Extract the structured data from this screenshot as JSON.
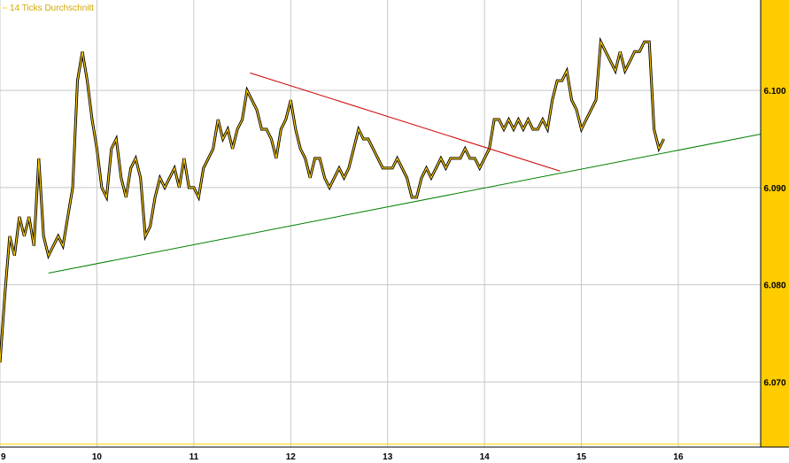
{
  "chart_data": {
    "type": "line",
    "legend": {
      "label": "14 Ticks Durchschnitt",
      "placement": "top-left"
    },
    "x_axis": {
      "range": [
        9,
        16.85
      ],
      "ticks": [
        "9",
        "10",
        "11",
        "12",
        "13",
        "14",
        "15",
        "16"
      ]
    },
    "y_axis": {
      "range": [
        6.0633,
        6.1093
      ],
      "side": "right",
      "ticks": [
        "6.070",
        "6.080",
        "6.090",
        "6.100"
      ]
    },
    "grid": true,
    "colors": {
      "price": "#000000",
      "average": "#ffcc00",
      "axis_panel": "#ffcc00",
      "resistance": "#cc0000",
      "support": "#008000",
      "reference": "#ffcc00"
    },
    "series": [
      {
        "name": "14 Ticks Durchschnitt",
        "points": [
          [
            9.0,
            6.072
          ],
          [
            9.05,
            6.079
          ],
          [
            9.1,
            6.085
          ],
          [
            9.15,
            6.083
          ],
          [
            9.2,
            6.087
          ],
          [
            9.25,
            6.085
          ],
          [
            9.3,
            6.087
          ],
          [
            9.35,
            6.084
          ],
          [
            9.4,
            6.093
          ],
          [
            9.45,
            6.085
          ],
          [
            9.5,
            6.083
          ],
          [
            9.55,
            6.084
          ],
          [
            9.6,
            6.085
          ],
          [
            9.65,
            6.084
          ],
          [
            9.7,
            6.087
          ],
          [
            9.75,
            6.09
          ],
          [
            9.8,
            6.101
          ],
          [
            9.85,
            6.104
          ],
          [
            9.9,
            6.101
          ],
          [
            9.95,
            6.097
          ],
          [
            10.0,
            6.094
          ],
          [
            10.05,
            6.09
          ],
          [
            10.1,
            6.089
          ],
          [
            10.15,
            6.094
          ],
          [
            10.2,
            6.095
          ],
          [
            10.25,
            6.091
          ],
          [
            10.3,
            6.089
          ],
          [
            10.35,
            6.092
          ],
          [
            10.4,
            6.093
          ],
          [
            10.45,
            6.091
          ],
          [
            10.5,
            6.085
          ],
          [
            10.55,
            6.086
          ],
          [
            10.6,
            6.089
          ],
          [
            10.65,
            6.091
          ],
          [
            10.7,
            6.09
          ],
          [
            10.75,
            6.091
          ],
          [
            10.8,
            6.092
          ],
          [
            10.85,
            6.09
          ],
          [
            10.9,
            6.093
          ],
          [
            10.95,
            6.09
          ],
          [
            11.0,
            6.09
          ],
          [
            11.05,
            6.089
          ],
          [
            11.1,
            6.092
          ],
          [
            11.15,
            6.093
          ],
          [
            11.2,
            6.094
          ],
          [
            11.25,
            6.097
          ],
          [
            11.3,
            6.095
          ],
          [
            11.35,
            6.096
          ],
          [
            11.4,
            6.094
          ],
          [
            11.45,
            6.096
          ],
          [
            11.5,
            6.097
          ],
          [
            11.55,
            6.1
          ],
          [
            11.6,
            6.099
          ],
          [
            11.65,
            6.098
          ],
          [
            11.7,
            6.096
          ],
          [
            11.75,
            6.096
          ],
          [
            11.8,
            6.095
          ],
          [
            11.85,
            6.093
          ],
          [
            11.9,
            6.096
          ],
          [
            11.95,
            6.097
          ],
          [
            12.0,
            6.099
          ],
          [
            12.05,
            6.096
          ],
          [
            12.1,
            6.094
          ],
          [
            12.15,
            6.093
          ],
          [
            12.2,
            6.091
          ],
          [
            12.25,
            6.093
          ],
          [
            12.3,
            6.093
          ],
          [
            12.35,
            6.091
          ],
          [
            12.4,
            6.09
          ],
          [
            12.45,
            6.091
          ],
          [
            12.5,
            6.092
          ],
          [
            12.55,
            6.091
          ],
          [
            12.6,
            6.092
          ],
          [
            12.65,
            6.094
          ],
          [
            12.7,
            6.096
          ],
          [
            12.75,
            6.095
          ],
          [
            12.8,
            6.095
          ],
          [
            12.85,
            6.094
          ],
          [
            12.9,
            6.093
          ],
          [
            12.95,
            6.092
          ],
          [
            13.0,
            6.092
          ],
          [
            13.05,
            6.092
          ],
          [
            13.1,
            6.093
          ],
          [
            13.15,
            6.092
          ],
          [
            13.2,
            6.091
          ],
          [
            13.25,
            6.089
          ],
          [
            13.3,
            6.089
          ],
          [
            13.35,
            6.091
          ],
          [
            13.4,
            6.092
          ],
          [
            13.45,
            6.091
          ],
          [
            13.5,
            6.092
          ],
          [
            13.55,
            6.093
          ],
          [
            13.6,
            6.092
          ],
          [
            13.65,
            6.093
          ],
          [
            13.7,
            6.093
          ],
          [
            13.75,
            6.093
          ],
          [
            13.8,
            6.094
          ],
          [
            13.85,
            6.093
          ],
          [
            13.9,
            6.093
          ],
          [
            13.95,
            6.092
          ],
          [
            14.0,
            6.093
          ],
          [
            14.05,
            6.094
          ],
          [
            14.1,
            6.097
          ],
          [
            14.15,
            6.097
          ],
          [
            14.2,
            6.096
          ],
          [
            14.25,
            6.097
          ],
          [
            14.3,
            6.096
          ],
          [
            14.35,
            6.097
          ],
          [
            14.4,
            6.096
          ],
          [
            14.45,
            6.097
          ],
          [
            14.5,
            6.096
          ],
          [
            14.55,
            6.096
          ],
          [
            14.6,
            6.097
          ],
          [
            14.65,
            6.096
          ],
          [
            14.7,
            6.099
          ],
          [
            14.75,
            6.101
          ],
          [
            14.8,
            6.101
          ],
          [
            14.85,
            6.102
          ],
          [
            14.9,
            6.099
          ],
          [
            14.95,
            6.098
          ],
          [
            15.0,
            6.096
          ],
          [
            15.05,
            6.097
          ],
          [
            15.1,
            6.098
          ],
          [
            15.15,
            6.099
          ],
          [
            15.2,
            6.105
          ],
          [
            15.25,
            6.104
          ],
          [
            15.3,
            6.103
          ],
          [
            15.35,
            6.102
          ],
          [
            15.4,
            6.104
          ],
          [
            15.45,
            6.102
          ],
          [
            15.5,
            6.103
          ],
          [
            15.55,
            6.104
          ],
          [
            15.6,
            6.104
          ],
          [
            15.65,
            6.105
          ],
          [
            15.7,
            6.105
          ],
          [
            15.75,
            6.096
          ],
          [
            15.8,
            6.094
          ],
          [
            15.85,
            6.095
          ]
        ]
      }
    ],
    "trendlines": [
      {
        "name": "resistance",
        "from": [
          11.58,
          6.1018
        ],
        "to": [
          14.78,
          6.0917
        ]
      },
      {
        "name": "support",
        "from": [
          9.5,
          6.0812
        ],
        "to": [
          16.85,
          6.0955
        ]
      }
    ],
    "reference_line": {
      "y": 6.0636
    }
  }
}
